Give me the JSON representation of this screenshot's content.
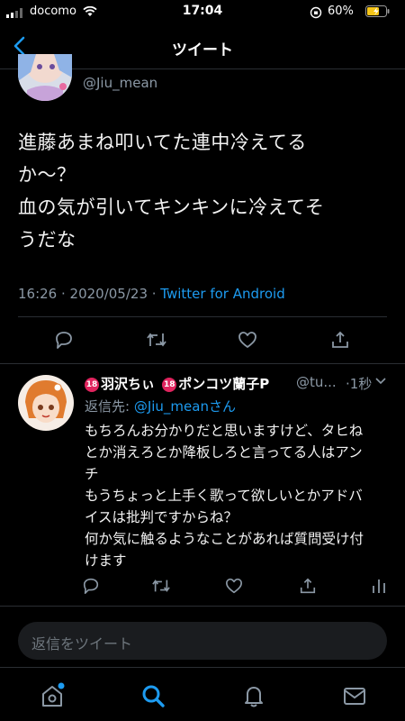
{
  "status_bar": {
    "carrier": "docomo",
    "time": "17:04",
    "battery": "60%"
  },
  "nav": {
    "back_icon": "chevron-left-icon",
    "title": "ツイート"
  },
  "tweet": {
    "handle": "@Jiu_mean",
    "text_lines": [
      "進藤あまね叩いてた連中冷えてる",
      "か～？",
      "血の気が引いてキンキンに冷えてそ",
      "うだな"
    ],
    "timestamp": "16:26 · 2020/05/23 · ",
    "source": "Twitter for Android",
    "actions": [
      "reply-icon",
      "retweet-icon",
      "like-icon",
      "share-icon"
    ]
  },
  "reply": {
    "name_badge": "18",
    "name_part1": "羽沢ちぃ",
    "name_part2": "ポンコツ蘭子P",
    "handle": "@tu...",
    "time": "·1秒",
    "reply_to_label": "返信先: ",
    "reply_to_handle": "@Jiu_mean",
    "reply_to_suffix": "さん",
    "text_lines": [
      "もちろんお分かりだと思いますけど、タヒね",
      "とか消えろとか降板しろと言ってる人はアン",
      "チ",
      "もうちょっと上手く歌って欲しいとかアドバ",
      "イスは批判ですからね？",
      "何か気に触るようなことがあれば質問受け付",
      "けます"
    ],
    "actions": [
      "reply-icon",
      "retweet-icon",
      "like-icon",
      "share-icon",
      "analytics-icon"
    ]
  },
  "compose": {
    "placeholder": "返信をツイート"
  },
  "tabs": [
    "home-icon",
    "search-icon",
    "notifications-icon",
    "messages-icon"
  ],
  "colors": {
    "accent": "#1d9bf0",
    "muted": "#8b98a5",
    "background": "#000000"
  }
}
